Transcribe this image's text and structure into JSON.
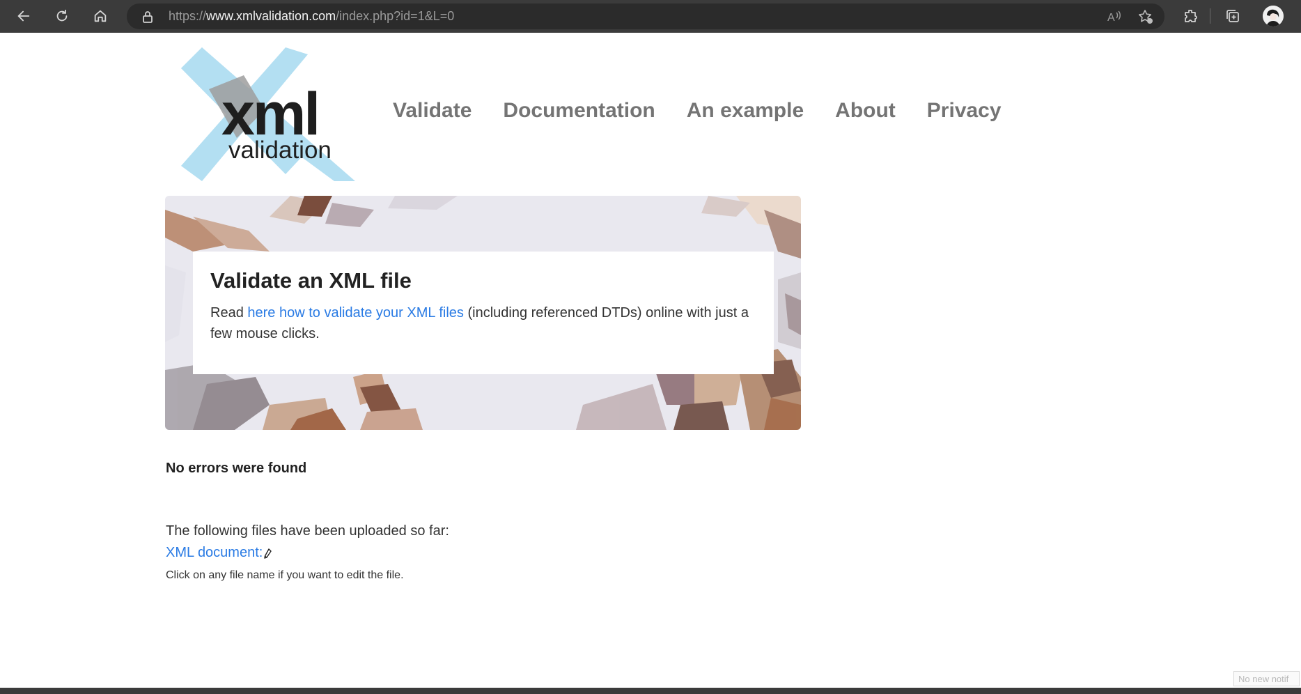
{
  "browser": {
    "url_scheme": "https://",
    "url_host": "www.xmlvalidation.com",
    "url_path": "/index.php?id=1&L=0",
    "icons": [
      "back-icon",
      "refresh-icon",
      "home-icon",
      "lock-icon",
      "read-aloud-icon",
      "favorites-icon",
      "extensions-icon",
      "collections-icon",
      "profile-avatar"
    ]
  },
  "logo": {
    "text_main": "xml",
    "text_sub": "validation"
  },
  "nav": {
    "items": [
      "Validate",
      "Documentation",
      "An example",
      "About",
      "Privacy"
    ]
  },
  "hero": {
    "title": "Validate an XML file",
    "text_before": "Read ",
    "link_text": "here how to validate your XML files",
    "text_after": " (including referenced DTDs) online with just a few mouse clicks."
  },
  "result": {
    "status": "No errors were found"
  },
  "files": {
    "intro": "The following files have been uploaded so far:",
    "xml_document_link": "XML document:",
    "hint": "Click on any file name if you want to edit the file."
  },
  "notification": {
    "text": "No new notif"
  },
  "colors": {
    "link": "#2a7be4",
    "nav": "#747474",
    "chrome": "#3b3b3b",
    "logo_x": "#b3dff2"
  }
}
